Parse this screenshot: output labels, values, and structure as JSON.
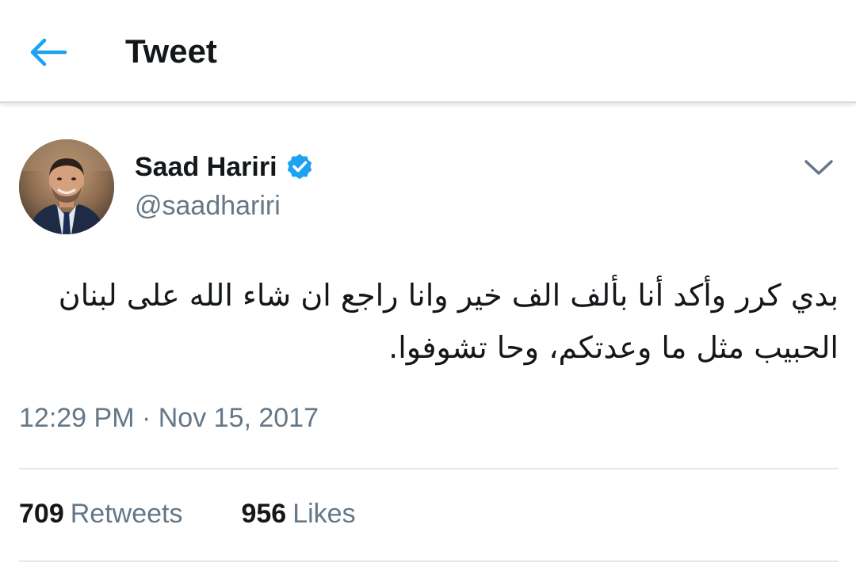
{
  "header": {
    "title": "Tweet",
    "back_icon": "arrow-left-icon"
  },
  "tweet": {
    "author": {
      "display_name": "Saad Hariri",
      "handle": "@saadhariri",
      "verified": true,
      "verified_icon": "verified-badge-icon"
    },
    "menu_icon": "chevron-down-icon",
    "text_line1": "بدي كرر  وأكد أنا بألف الف خير وانا راجع ان شاء الله على لبنان",
    "text_line2": "الحبيب مثل ما وعدتكم، وحا تشوفوا.",
    "timestamp": "12:29 PM · Nov 15, 2017",
    "stats": {
      "retweets_count": "709",
      "retweets_label": "Retweets",
      "likes_count": "956",
      "likes_label": "Likes"
    }
  },
  "colors": {
    "accent": "#1da1f2",
    "text_primary": "#14171a",
    "text_secondary": "#657786",
    "divider": "#e1e8ed"
  }
}
